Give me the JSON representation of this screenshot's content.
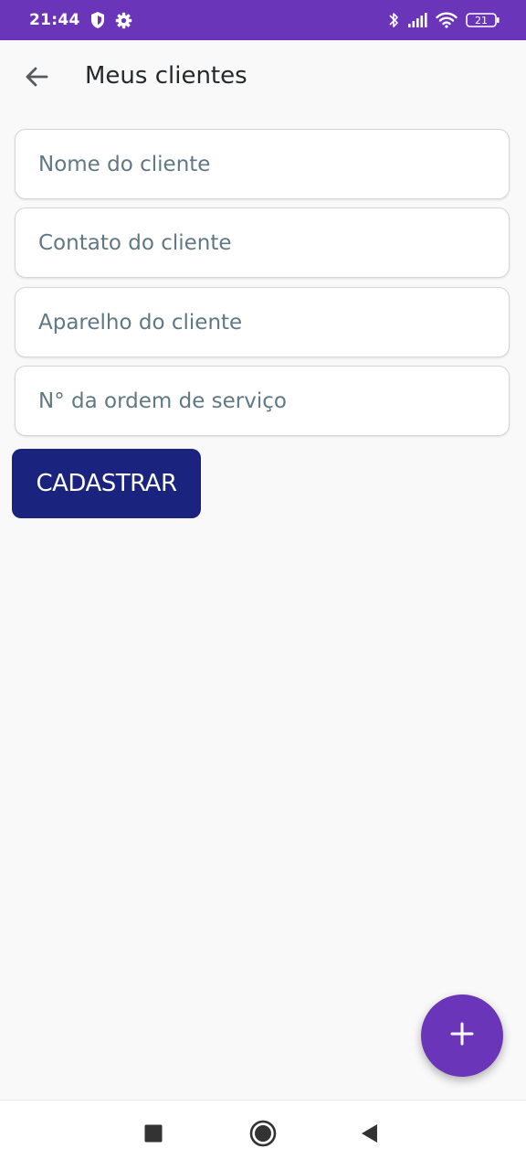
{
  "status_bar": {
    "time": "21:44",
    "battery": "21",
    "icons": [
      "shield-icon",
      "gear-icon",
      "bluetooth-icon",
      "signal-icon",
      "wifi-icon",
      "battery-icon"
    ]
  },
  "header": {
    "title": "Meus clientes",
    "back_icon": "arrow-left-icon"
  },
  "form": {
    "fields": [
      {
        "placeholder": "Nome do cliente",
        "value": ""
      },
      {
        "placeholder": "Contato do cliente",
        "value": ""
      },
      {
        "placeholder": "Aparelho do cliente",
        "value": ""
      },
      {
        "placeholder": "N° da ordem de serviço",
        "value": ""
      }
    ],
    "submit_label": "CADASTRAR"
  },
  "fab": {
    "icon": "plus-icon"
  },
  "nav_bar": {
    "icons": [
      "recents-square-icon",
      "home-circle-icon",
      "back-triangle-icon"
    ]
  },
  "colors": {
    "accent": "#6a35b8",
    "button": "#1a237e",
    "background": "#f9f9f9",
    "placeholder": "#607883"
  }
}
